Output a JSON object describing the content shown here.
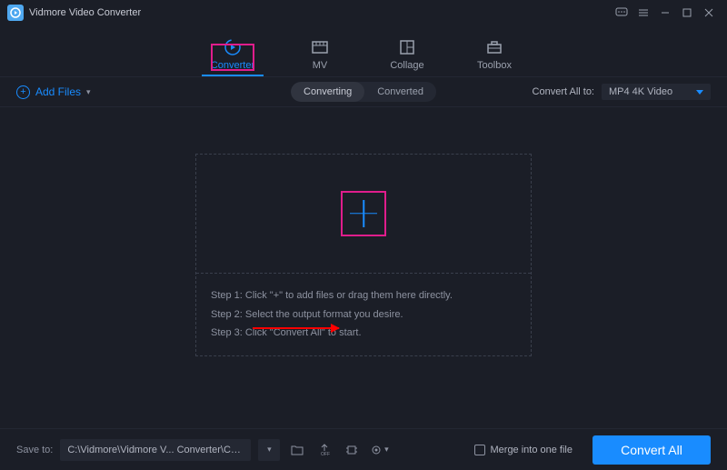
{
  "app": {
    "title": "Vidmore Video Converter"
  },
  "tabs": {
    "converter": "Converter",
    "mv": "MV",
    "collage": "Collage",
    "toolbox": "Toolbox"
  },
  "toolbar": {
    "add_files": "Add Files",
    "converting": "Converting",
    "converted": "Converted",
    "convert_all_to": "Convert All to:",
    "selected_format": "MP4 4K Video"
  },
  "dropzone": {
    "step1": "Step 1: Click \"+\" to add files or drag them here directly.",
    "step2": "Step 2: Select the output format you desire.",
    "step3": "Step 3: Click \"Convert All\" to start."
  },
  "bottom": {
    "save_to": "Save to:",
    "path": "C:\\Vidmore\\Vidmore V... Converter\\Converted",
    "merge": "Merge into one file",
    "convert_all": "Convert All"
  }
}
